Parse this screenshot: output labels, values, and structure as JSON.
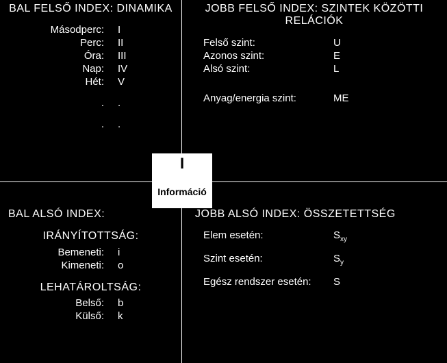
{
  "center": {
    "symbol": "I",
    "label": "Információ"
  },
  "tl": {
    "title": "BAL FELSŐ INDEX: DINAMIKA",
    "rows": [
      {
        "k": "Másodperc:",
        "v": "I"
      },
      {
        "k": "Perc:",
        "v": "II"
      },
      {
        "k": "Óra:",
        "v": "III"
      },
      {
        "k": "Nap:",
        "v": "IV"
      },
      {
        "k": "Hét:",
        "v": "V"
      },
      {
        "k": ".",
        "v": "."
      },
      {
        "k": ".",
        "v": "."
      }
    ]
  },
  "tr": {
    "title": "JOBB FELSŐ INDEX: SZINTEK KÖZÖTTI RELÁCIÓK",
    "rows": [
      {
        "k": "Felső szint:",
        "v": "U"
      },
      {
        "k": "Azonos szint:",
        "v": "E"
      },
      {
        "k": "Alsó szint:",
        "v": "L"
      }
    ],
    "extra": {
      "k": "Anyag/energia szint:",
      "v": "ME"
    }
  },
  "bl": {
    "title": "BAL ALSÓ INDEX:",
    "group1": {
      "heading": "IRÁNYÍTOTTSÁG:",
      "rows": [
        {
          "k": "Bemeneti:",
          "v": "i"
        },
        {
          "k": "Kimeneti:",
          "v": "o"
        }
      ]
    },
    "group2": {
      "heading": "LEHATÁROLTSÁG:",
      "rows": [
        {
          "k": "Belső:",
          "v": "b"
        },
        {
          "k": "Külső:",
          "v": "k"
        }
      ]
    }
  },
  "br": {
    "title": "JOBB ALSÓ INDEX: ÖSSZETETTSÉG",
    "rows": [
      {
        "k": "Elem esetén:",
        "v": "S",
        "sub": "xy"
      },
      {
        "k": "Szint esetén:",
        "v": "S",
        "sub": "y"
      },
      {
        "k": "Egész rendszer esetén:",
        "v": "S",
        "sub": ""
      }
    ]
  }
}
